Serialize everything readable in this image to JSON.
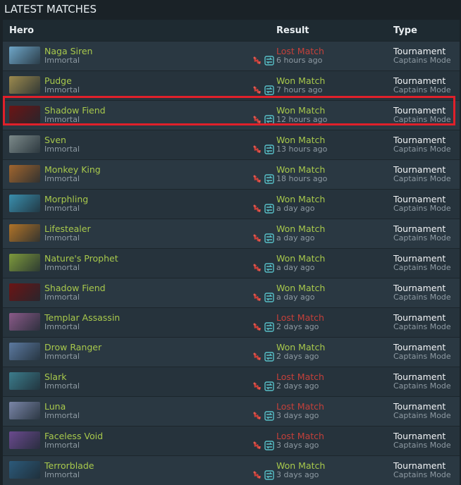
{
  "page": {
    "title": "LATEST MATCHES"
  },
  "header": {
    "hero": "Hero",
    "result": "Result",
    "type": "Type"
  },
  "colors": {
    "won": "#a8c94c",
    "lost": "#c4403a",
    "highlight": "#e0202a"
  },
  "icons": [
    "feet-icon",
    "swap-icon"
  ],
  "matches": [
    {
      "hero": "Naga Siren",
      "rank": "Immortal",
      "result": "Lost Match",
      "outcome": "lost",
      "time": "6 hours ago",
      "type": "Tournament",
      "mode": "Captains Mode",
      "portrait": "#6fa6c8"
    },
    {
      "hero": "Pudge",
      "rank": "Immortal",
      "result": "Won Match",
      "outcome": "won",
      "time": "7 hours ago",
      "type": "Tournament",
      "mode": "Captains Mode",
      "portrait": "#9c8a4e"
    },
    {
      "hero": "Shadow Fiend",
      "rank": "Immortal",
      "result": "Won Match",
      "outcome": "won",
      "time": "12 hours ago",
      "type": "Tournament",
      "mode": "Captains Mode",
      "portrait": "#6b1414"
    },
    {
      "hero": "Sven",
      "rank": "Immortal",
      "result": "Won Match",
      "outcome": "won",
      "time": "13 hours ago",
      "type": "Tournament",
      "mode": "Captains Mode",
      "portrait": "#7c8a8a"
    },
    {
      "hero": "Monkey King",
      "rank": "Immortal",
      "result": "Won Match",
      "outcome": "won",
      "time": "18 hours ago",
      "type": "Tournament",
      "mode": "Captains Mode",
      "portrait": "#a0652e"
    },
    {
      "hero": "Morphling",
      "rank": "Immortal",
      "result": "Won Match",
      "outcome": "won",
      "time": "a day ago",
      "type": "Tournament",
      "mode": "Captains Mode",
      "portrait": "#3a8fae"
    },
    {
      "hero": "Lifestealer",
      "rank": "Immortal",
      "result": "Won Match",
      "outcome": "won",
      "time": "a day ago",
      "type": "Tournament",
      "mode": "Captains Mode",
      "portrait": "#b07328"
    },
    {
      "hero": "Nature's Prophet",
      "rank": "Immortal",
      "result": "Won Match",
      "outcome": "won",
      "time": "a day ago",
      "type": "Tournament",
      "mode": "Captains Mode",
      "portrait": "#7e9a3c"
    },
    {
      "hero": "Shadow Fiend",
      "rank": "Immortal",
      "result": "Won Match",
      "outcome": "won",
      "time": "a day ago",
      "type": "Tournament",
      "mode": "Captains Mode",
      "portrait": "#6b1414"
    },
    {
      "hero": "Templar Assassin",
      "rank": "Immortal",
      "result": "Lost Match",
      "outcome": "lost",
      "time": "2 days ago",
      "type": "Tournament",
      "mode": "Captains Mode",
      "portrait": "#8a5a88"
    },
    {
      "hero": "Drow Ranger",
      "rank": "Immortal",
      "result": "Won Match",
      "outcome": "won",
      "time": "2 days ago",
      "type": "Tournament",
      "mode": "Captains Mode",
      "portrait": "#5c7aa0"
    },
    {
      "hero": "Slark",
      "rank": "Immortal",
      "result": "Lost Match",
      "outcome": "lost",
      "time": "2 days ago",
      "type": "Tournament",
      "mode": "Captains Mode",
      "portrait": "#3c7c8c"
    },
    {
      "hero": "Luna",
      "rank": "Immortal",
      "result": "Lost Match",
      "outcome": "lost",
      "time": "3 days ago",
      "type": "Tournament",
      "mode": "Captains Mode",
      "portrait": "#7a86a8"
    },
    {
      "hero": "Faceless Void",
      "rank": "Immortal",
      "result": "Lost Match",
      "outcome": "lost",
      "time": "3 days ago",
      "type": "Tournament",
      "mode": "Captains Mode",
      "portrait": "#6a4a8e"
    },
    {
      "hero": "Terrorblade",
      "rank": "Immortal",
      "result": "Won Match",
      "outcome": "won",
      "time": "3 days ago",
      "type": "Tournament",
      "mode": "Captains Mode",
      "portrait": "#2c5a7a"
    }
  ]
}
